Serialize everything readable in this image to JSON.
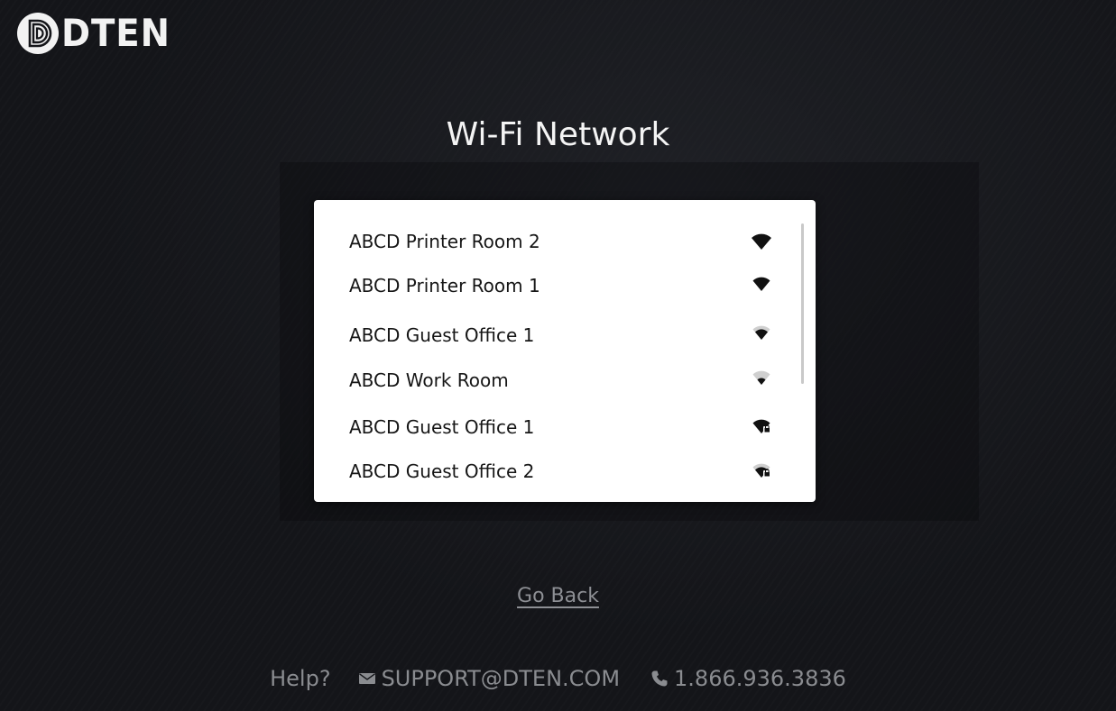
{
  "brand": {
    "logo_text": "DTEN",
    "logo_icon": "dten-logo-mark"
  },
  "page": {
    "title": "Wi-Fi Network"
  },
  "networks": [
    {
      "name": "ABCD Printer Room 2",
      "signal": "wifi-strong-icon",
      "secured": false
    },
    {
      "name": "ABCD Printer Room 1",
      "signal": "wifi-strong-icon",
      "secured": false
    },
    {
      "name": "ABCD Guest Office 1",
      "signal": "wifi-medium-icon",
      "secured": false
    },
    {
      "name": "ABCD Work Room",
      "signal": "wifi-weak-icon",
      "secured": false
    },
    {
      "name": "ABCD Guest Office 1",
      "signal": "wifi-lock-icon",
      "secured": true
    },
    {
      "name": "ABCD Guest Office 2",
      "signal": "wifi-lock-icon",
      "secured": true
    }
  ],
  "actions": {
    "go_back": "Go Back"
  },
  "footer": {
    "help_label": "Help?",
    "email": "SUPPORT@DTEN.COM",
    "email_icon": "envelope-icon",
    "phone": "1.866.936.3836",
    "phone_icon": "phone-icon"
  },
  "colors": {
    "background": "#141519",
    "list_background": "#ffffff",
    "title_text": "#f4f4f4",
    "muted_text": "#8a8c90",
    "item_text": "#161616"
  }
}
